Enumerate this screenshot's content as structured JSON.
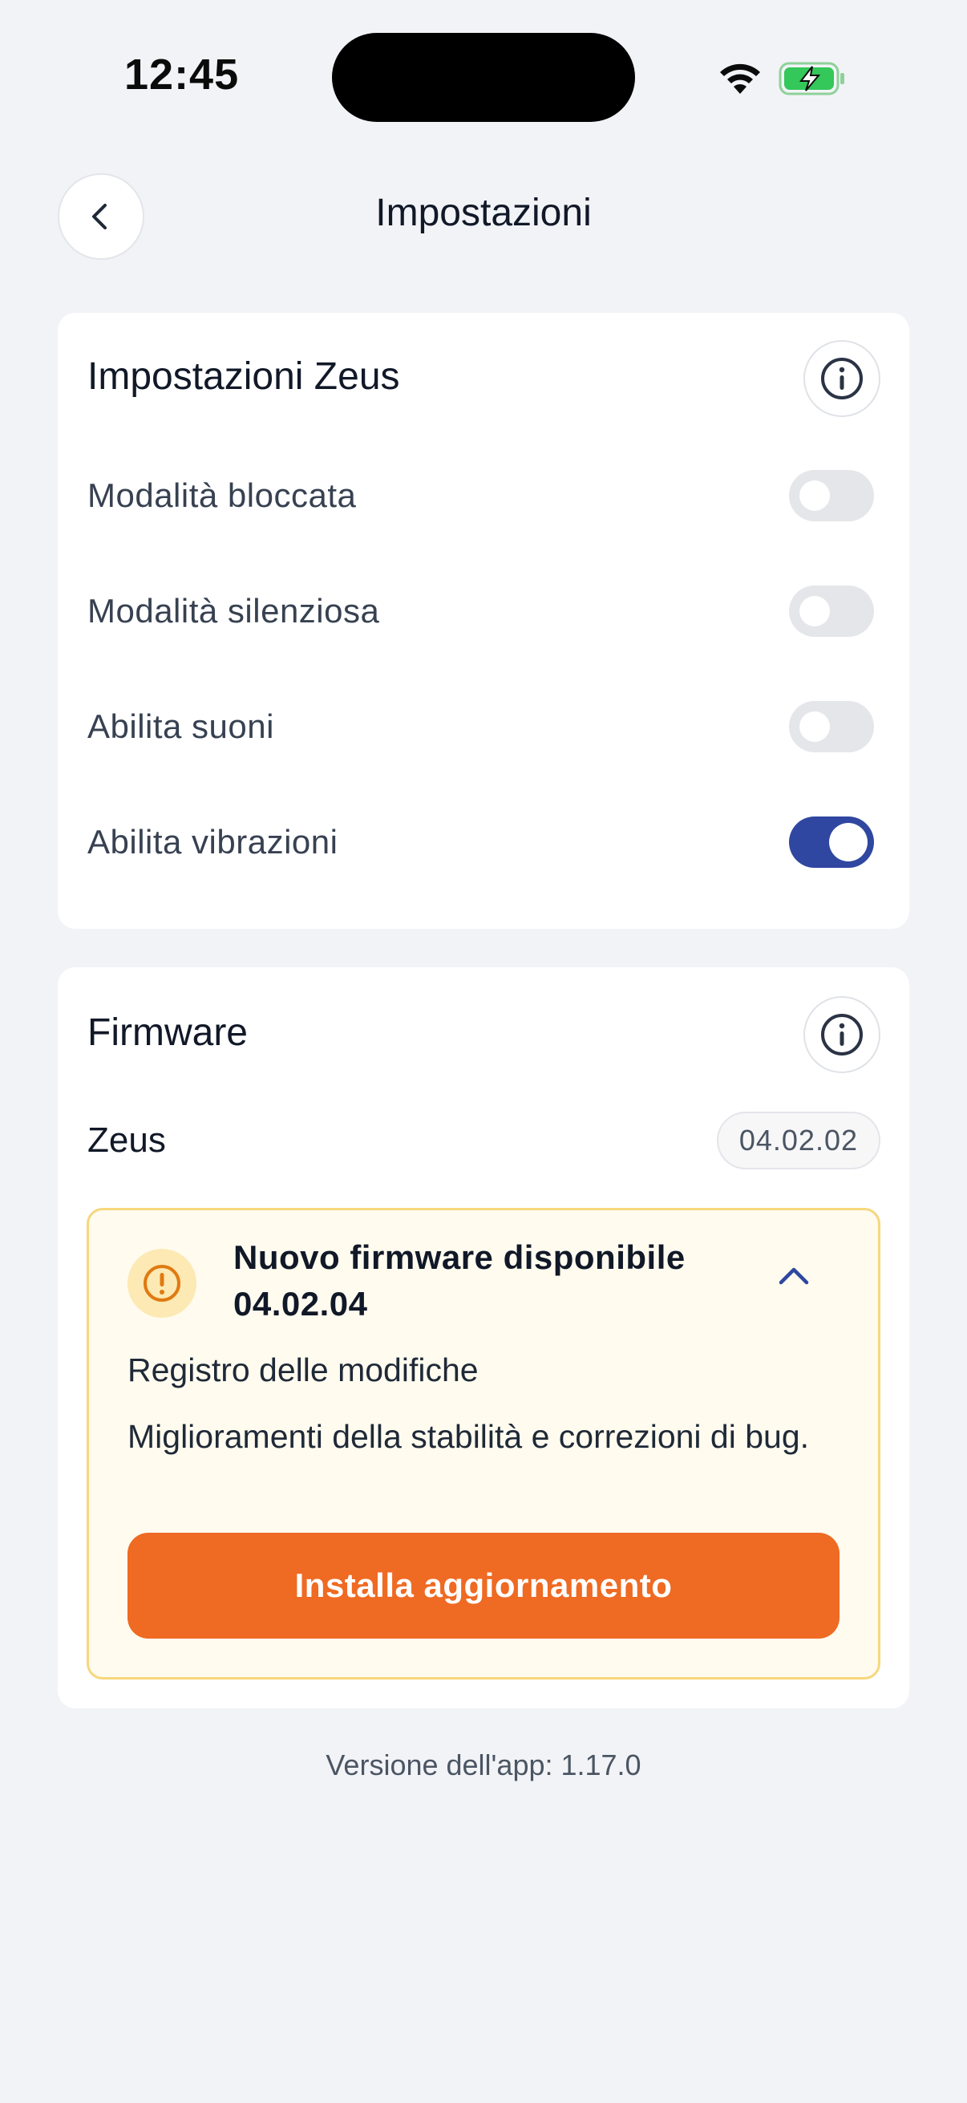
{
  "status_bar": {
    "time": "12:45",
    "icons": [
      "wifi-icon",
      "battery-charging-icon"
    ]
  },
  "header": {
    "title": "Impostazioni",
    "back_icon": "chevron-left-icon"
  },
  "settings_card": {
    "title": "Impostazioni Zeus",
    "items": [
      {
        "label": "Modalità bloccata",
        "enabled": false
      },
      {
        "label": "Modalità silenziosa",
        "enabled": false
      },
      {
        "label": "Abilita suoni",
        "enabled": false
      },
      {
        "label": "Abilita vibrazioni",
        "enabled": true
      }
    ]
  },
  "firmware_card": {
    "title": "Firmware",
    "device": {
      "name": "Zeus",
      "version": "04.02.02"
    },
    "update": {
      "title": "Nuovo firmware disponibile 04.02.04",
      "changelog_label": "Registro delle modifiche",
      "changelog_text": "Miglioramenti della stabilità e correzioni di bug.",
      "install_label": "Installa aggiornamento",
      "expanded": true
    }
  },
  "app_version": "Versione dell'app: 1.17.0",
  "colors": {
    "background": "#f2f3f7",
    "toggle_on": "#2f47a0",
    "toggle_off": "#e5e6ea",
    "accent_orange": "#ef6a22",
    "update_box_bg": "#fffbef",
    "update_box_border": "#f6d77c"
  }
}
